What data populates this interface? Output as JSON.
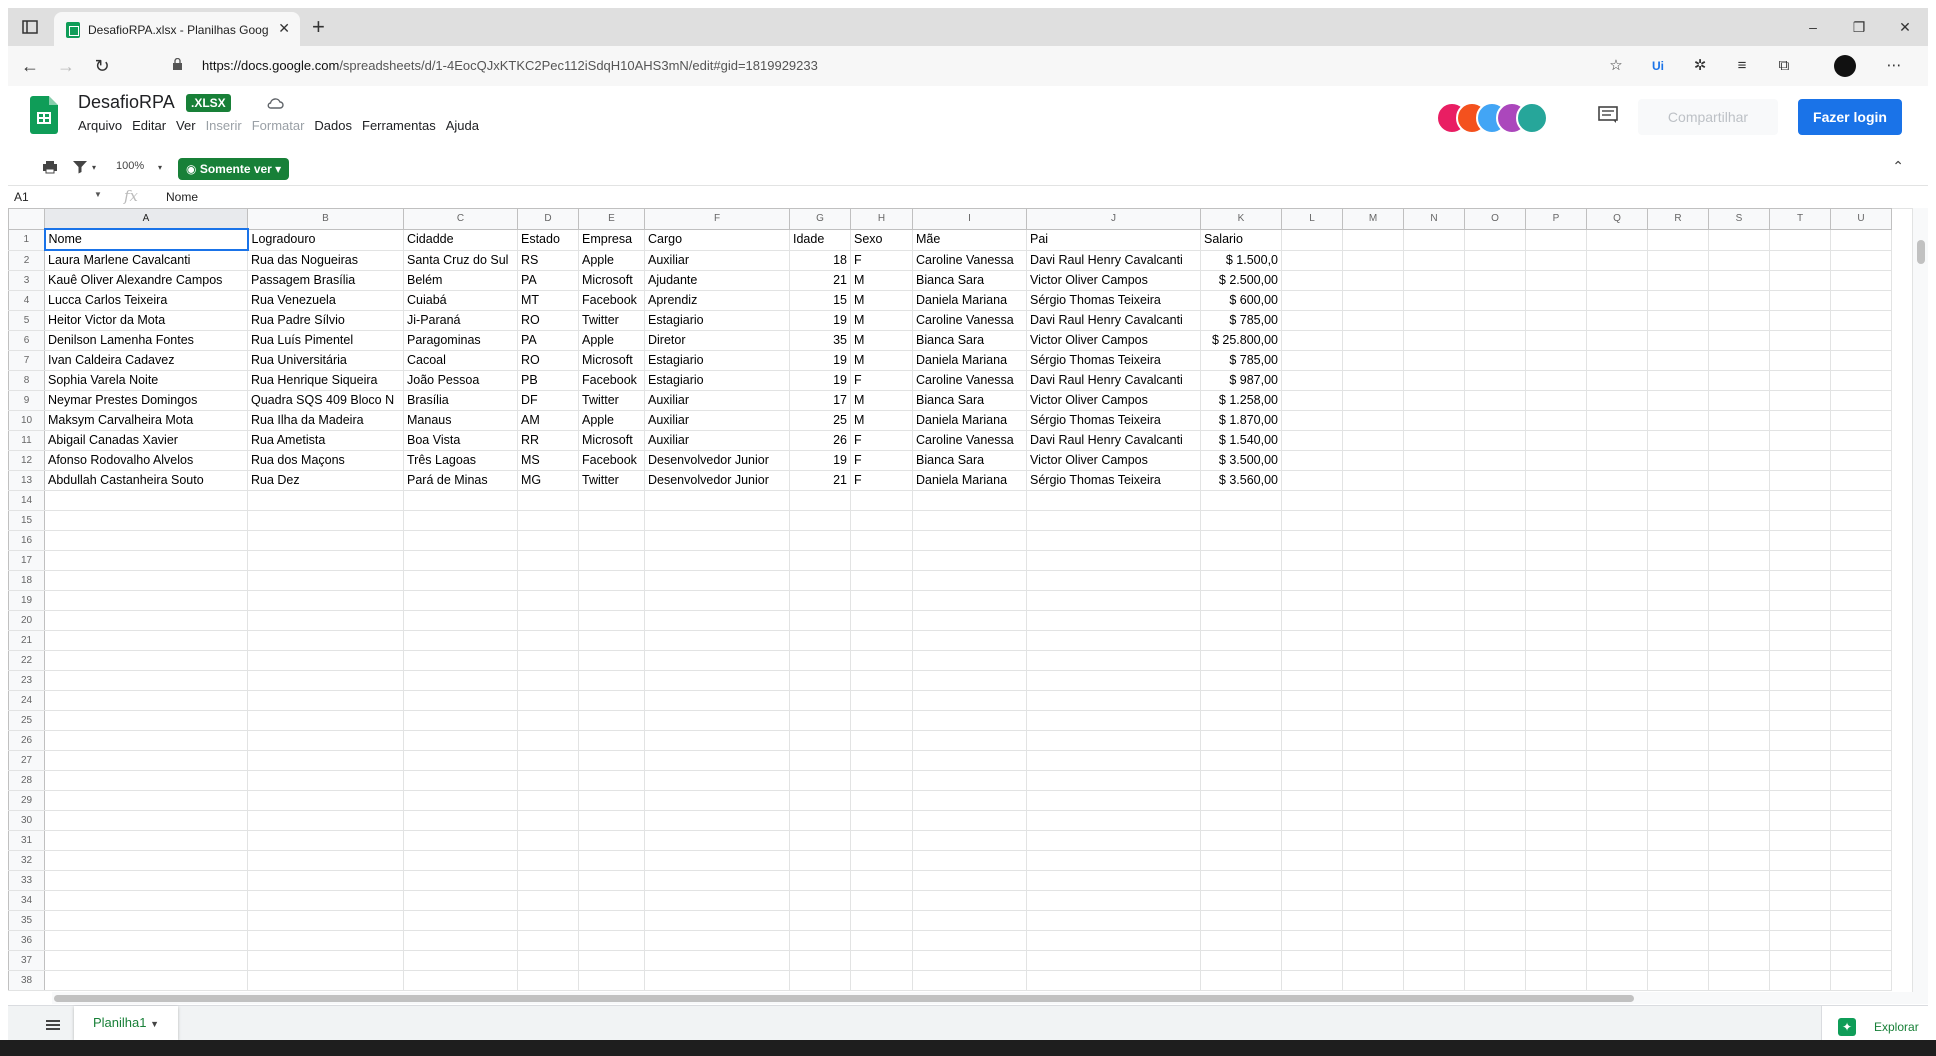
{
  "browser": {
    "tab_title": "DesafioRPA.xlsx - Planilhas Goog",
    "url_base": "https://docs.google.com",
    "url_path": "/spreadsheets/d/1-4EocQJxKTKC2Pec112iSdqH10AHS3mN/edit#gid=1819929233",
    "new_tab": "+",
    "win_min": "–",
    "win_restore": "❐",
    "win_close": "✕"
  },
  "doc": {
    "title": "DesafioRPA",
    "badge": ".XLSX",
    "menus": [
      "Arquivo",
      "Editar",
      "Ver",
      "Inserir",
      "Formatar",
      "Dados",
      "Ferramentas",
      "Ajuda"
    ],
    "share_label": "Compartilhar",
    "login_label": "Fazer login"
  },
  "toolbar": {
    "zoom": "100%",
    "view_only": "Somente ver"
  },
  "formula_bar": {
    "cell_ref": "A1",
    "fx": "fx",
    "value": "Nome"
  },
  "sheet": {
    "columns": [
      "A",
      "B",
      "C",
      "D",
      "E",
      "F",
      "G",
      "H",
      "I",
      "J",
      "K",
      "L",
      "M",
      "N",
      "O",
      "P",
      "Q",
      "R",
      "S",
      "T",
      "U"
    ],
    "rows": [
      [
        "Nome",
        "Logradouro",
        "Cidadde",
        "Estado",
        "Empresa",
        "Cargo",
        "Idade",
        "Sexo",
        "Mãe",
        "Pai",
        "Salario"
      ],
      [
        "Laura Marlene Cavalcanti",
        "Rua das Nogueiras",
        "Santa Cruz do Sul",
        "RS",
        "Apple",
        "Auxiliar",
        "18",
        "F",
        "Caroline Vanessa",
        "Davi Raul Henry Cavalcanti",
        "$  1.500,0"
      ],
      [
        "Kauê Oliver Alexandre Campos",
        "Passagem Brasília",
        "Belém",
        "PA",
        "Microsoft",
        "Ajudante",
        "21",
        "M",
        "Bianca Sara",
        "Victor Oliver Campos",
        "$  2.500,00"
      ],
      [
        "Lucca Carlos Teixeira",
        "Rua Venezuela",
        "Cuiabá",
        "MT",
        "Facebook",
        "Aprendiz",
        "15",
        "M",
        "Daniela Mariana",
        "Sérgio Thomas Teixeira",
        "$     600,00"
      ],
      [
        "Heitor Victor da Mota",
        "Rua Padre Sílvio",
        "Ji-Paraná",
        "RO",
        "Twitter",
        "Estagiario",
        "19",
        "M",
        "Caroline Vanessa",
        "Davi Raul Henry Cavalcanti",
        "$     785,00"
      ],
      [
        "Denilson Lamenha Fontes",
        "Rua Luís Pimentel",
        "Paragominas",
        "PA",
        "Apple",
        "Diretor",
        "35",
        "M",
        "Bianca Sara",
        "Victor Oliver Campos",
        "$ 25.800,00"
      ],
      [
        "Ivan Caldeira Cadavez",
        "Rua Universitária",
        "Cacoal",
        "RO",
        "Microsoft",
        "Estagiario",
        "19",
        "M",
        "Daniela Mariana",
        "Sérgio Thomas Teixeira",
        "$     785,00"
      ],
      [
        "Sophia Varela Noite",
        "Rua Henrique Siqueira",
        "João Pessoa",
        "PB",
        "Facebook",
        "Estagiario",
        "19",
        "F",
        "Caroline Vanessa",
        "Davi Raul Henry Cavalcanti",
        "$     987,00"
      ],
      [
        "Neymar Prestes Domingos",
        "Quadra SQS 409 Bloco N",
        "Brasília",
        "DF",
        "Twitter",
        "Auxiliar",
        "17",
        "M",
        "Bianca Sara",
        "Victor Oliver Campos",
        "$  1.258,00"
      ],
      [
        "Maksym Carvalheira Mota",
        "Rua Ilha da Madeira",
        "Manaus",
        "AM",
        "Apple",
        "Auxiliar",
        "25",
        "M",
        "Daniela Mariana",
        "Sérgio Thomas Teixeira",
        "$  1.870,00"
      ],
      [
        "Abigail Canadas Xavier",
        "Rua Ametista",
        "Boa Vista",
        "RR",
        "Microsoft",
        "Auxiliar",
        "26",
        "F",
        "Caroline Vanessa",
        "Davi Raul Henry Cavalcanti",
        "$  1.540,00"
      ],
      [
        "Afonso Rodovalho Alvelos",
        "Rua dos Maçons",
        "Três Lagoas",
        "MS",
        "Facebook",
        "Desenvolvedor Junior",
        "19",
        "F",
        "Bianca Sara",
        "Victor Oliver Campos",
        "$  3.500,00"
      ],
      [
        "Abdullah Castanheira Souto",
        "Rua Dez",
        "Pará de Minas",
        "MG",
        "Twitter",
        "Desenvolvedor Junior",
        "21",
        "F",
        "Daniela Mariana",
        "Sérgio Thomas Teixeira",
        "$  3.560,00"
      ]
    ],
    "total_rows": 38,
    "sheet_tab": "Planilha1",
    "explore_label": "Explorar"
  },
  "colors": {
    "green": "#188038",
    "blue": "#1a73e8",
    "avatars": [
      "#e91e63",
      "#f4511e",
      "#42a5f5",
      "#ab47bc",
      "#26a69a"
    ]
  }
}
